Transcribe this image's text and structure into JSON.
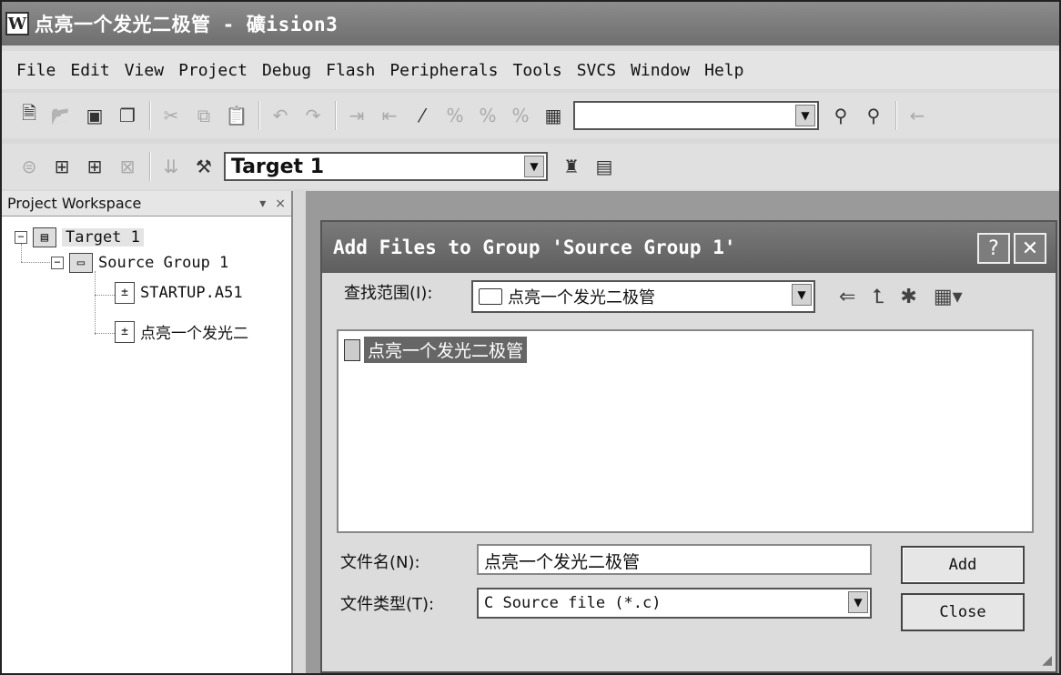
{
  "window": {
    "title": "点亮一个发光二极管  - 礦ision3",
    "icon_letter": "W"
  },
  "menu": [
    {
      "label": "File"
    },
    {
      "label": "Edit"
    },
    {
      "label": "View"
    },
    {
      "label": "Project"
    },
    {
      "label": "Debug"
    },
    {
      "label": "Flash"
    },
    {
      "label": "Peripherals"
    },
    {
      "label": "Tools"
    },
    {
      "label": "SVCS"
    },
    {
      "label": "Window"
    },
    {
      "label": "Help"
    }
  ],
  "toolbar2": {
    "target_select": "Target 1"
  },
  "workspace": {
    "title": "Project Workspace",
    "pin_glyph": "▾",
    "close_glyph": "×",
    "tree": {
      "target": "Target 1",
      "group": "Source Group 1",
      "files": [
        "STARTUP.A51",
        "点亮一个发光二"
      ]
    }
  },
  "dialog": {
    "title": "Add Files to Group 'Source Group 1'",
    "help_glyph": "?",
    "close_glyph": "✕",
    "lookin_label": "查找范围(I):",
    "lookin_value": "点亮一个发光二极管",
    "list_items": [
      "点亮一个发光二极管"
    ],
    "filename_label": "文件名(N):",
    "filename_value": "点亮一个发光二极管",
    "filetype_label": "文件类型(T):",
    "filetype_value": "C Source file (*.c)",
    "add_label": "Add",
    "close_label": "Close"
  },
  "icons": {
    "toolbar1": [
      "new-file-icon",
      "open-icon",
      "save-icon",
      "save-all-icon",
      "cut-icon",
      "copy-icon",
      "paste-icon",
      "undo-icon",
      "redo-icon",
      "indent-icon",
      "unindent-icon",
      "bookmark-icon",
      "prev-bookmark-icon",
      "next-bookmark-icon",
      "clear-bookmarks-icon",
      "find-in-files-icon",
      "find-icon",
      "find-next-icon",
      "back-icon"
    ],
    "toolbar2": [
      "translate-icon",
      "build-icon",
      "rebuild-icon",
      "stop-build-icon",
      "load-icon",
      "options-icon",
      "manage-components-icon",
      "select-device-icon"
    ]
  }
}
